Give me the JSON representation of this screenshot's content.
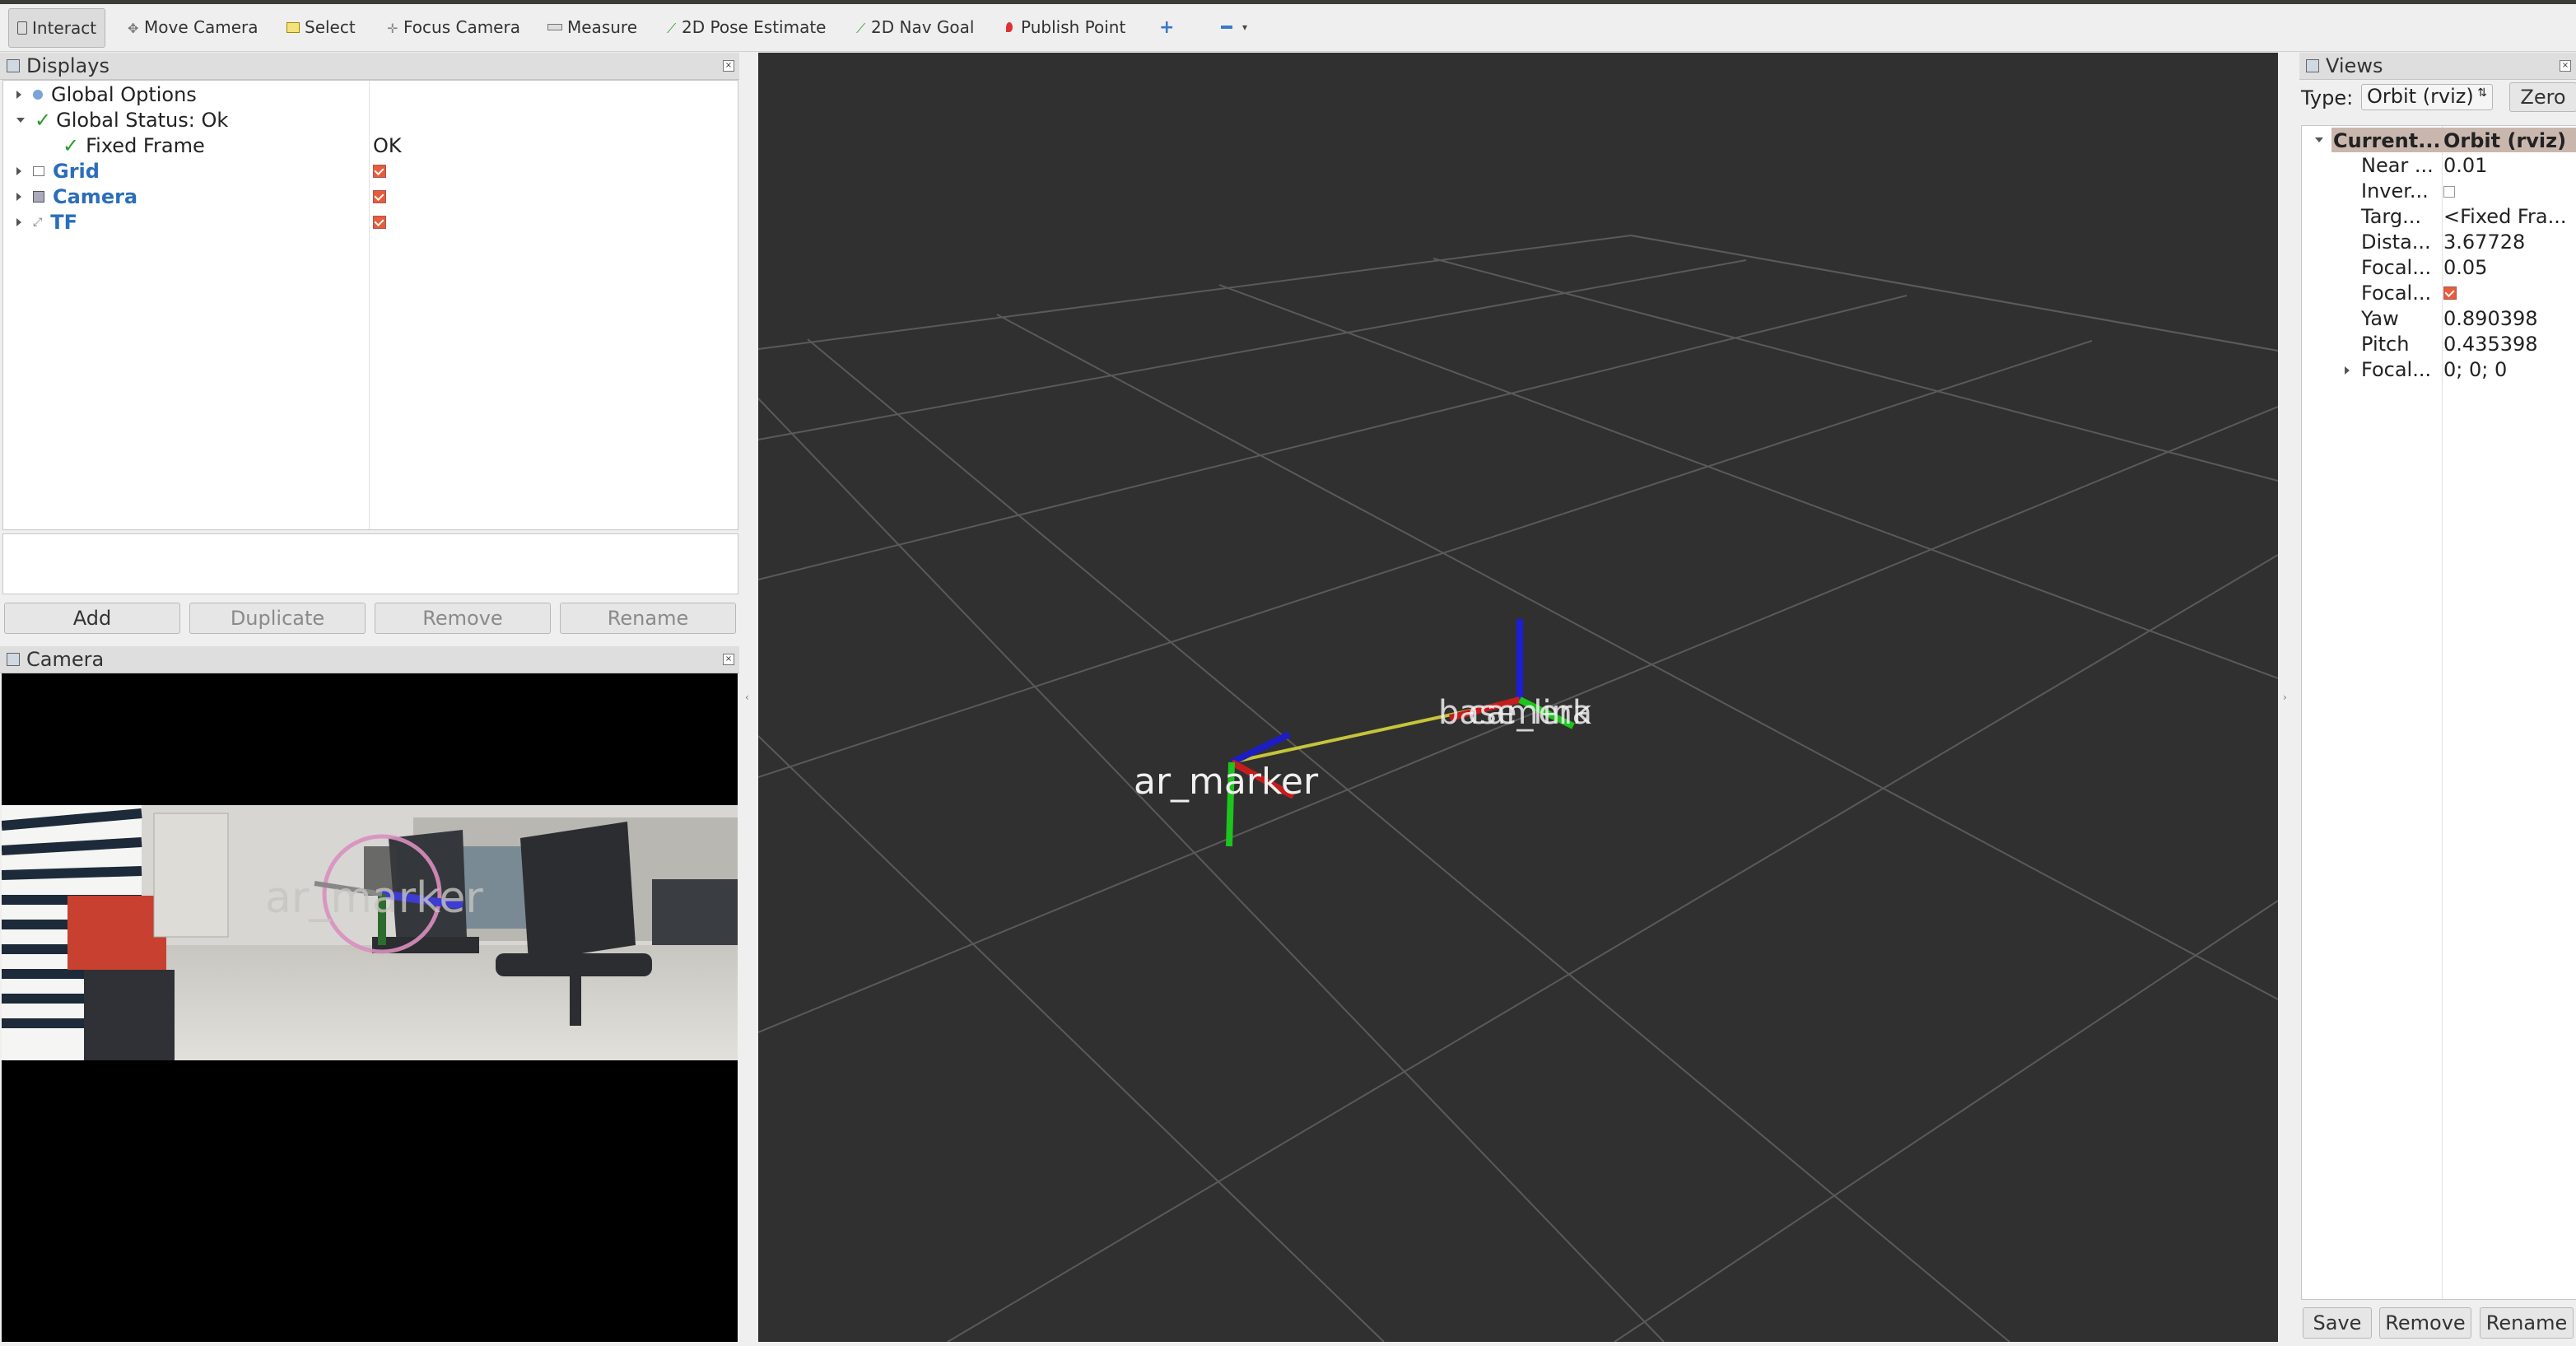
{
  "toolbar": {
    "tools": [
      {
        "label": "Interact",
        "icon": "cursor-icon"
      },
      {
        "label": "Move Camera",
        "icon": "move-camera-icon"
      },
      {
        "label": "Select",
        "icon": "select-icon"
      },
      {
        "label": "Focus Camera",
        "icon": "focus-camera-icon"
      },
      {
        "label": "Measure",
        "icon": "ruler-icon"
      },
      {
        "label": "2D Pose Estimate",
        "icon": "green-arrow-icon"
      },
      {
        "label": "2D Nav Goal",
        "icon": "green-arrow-icon"
      },
      {
        "label": "Publish Point",
        "icon": "map-pin-icon"
      }
    ]
  },
  "displays": {
    "title": "Displays",
    "items": [
      {
        "label": "Global Options",
        "value": ""
      },
      {
        "label": "Global Status: Ok",
        "value": ""
      },
      {
        "label": "Fixed Frame",
        "value": "OK"
      },
      {
        "label": "Grid",
        "value": ""
      },
      {
        "label": "Camera",
        "value": ""
      },
      {
        "label": "TF",
        "value": ""
      }
    ],
    "buttons": {
      "add": "Add",
      "duplicate": "Duplicate",
      "remove": "Remove",
      "rename": "Rename"
    }
  },
  "camera_panel": {
    "title": "Camera",
    "overlay_label": "ar_marker"
  },
  "viewport": {
    "background": "#303030",
    "labels": {
      "marker": "ar_marker",
      "base": "base_link",
      "camera": "camera"
    }
  },
  "views": {
    "title": "Views",
    "type_label": "Type:",
    "type_value": "Orbit (rviz)",
    "zero_button": "Zero",
    "header": {
      "key": "Current...",
      "value": "Orbit (rviz)"
    },
    "properties": [
      {
        "key": "Near ...",
        "value": "0.01"
      },
      {
        "key": "Inver...",
        "value": ""
      },
      {
        "key": "Targ...",
        "value": "<Fixed Fra..."
      },
      {
        "key": "Dista...",
        "value": "3.67728"
      },
      {
        "key": "Focal...",
        "value": "0.05"
      },
      {
        "key": "Focal...",
        "value": ""
      },
      {
        "key": "Yaw",
        "value": "0.890398"
      },
      {
        "key": "Pitch",
        "value": "0.435398"
      },
      {
        "key": "Focal...",
        "value": "0; 0; 0"
      }
    ],
    "buttons": {
      "save": "Save",
      "remove": "Remove",
      "rename": "Rename"
    }
  }
}
